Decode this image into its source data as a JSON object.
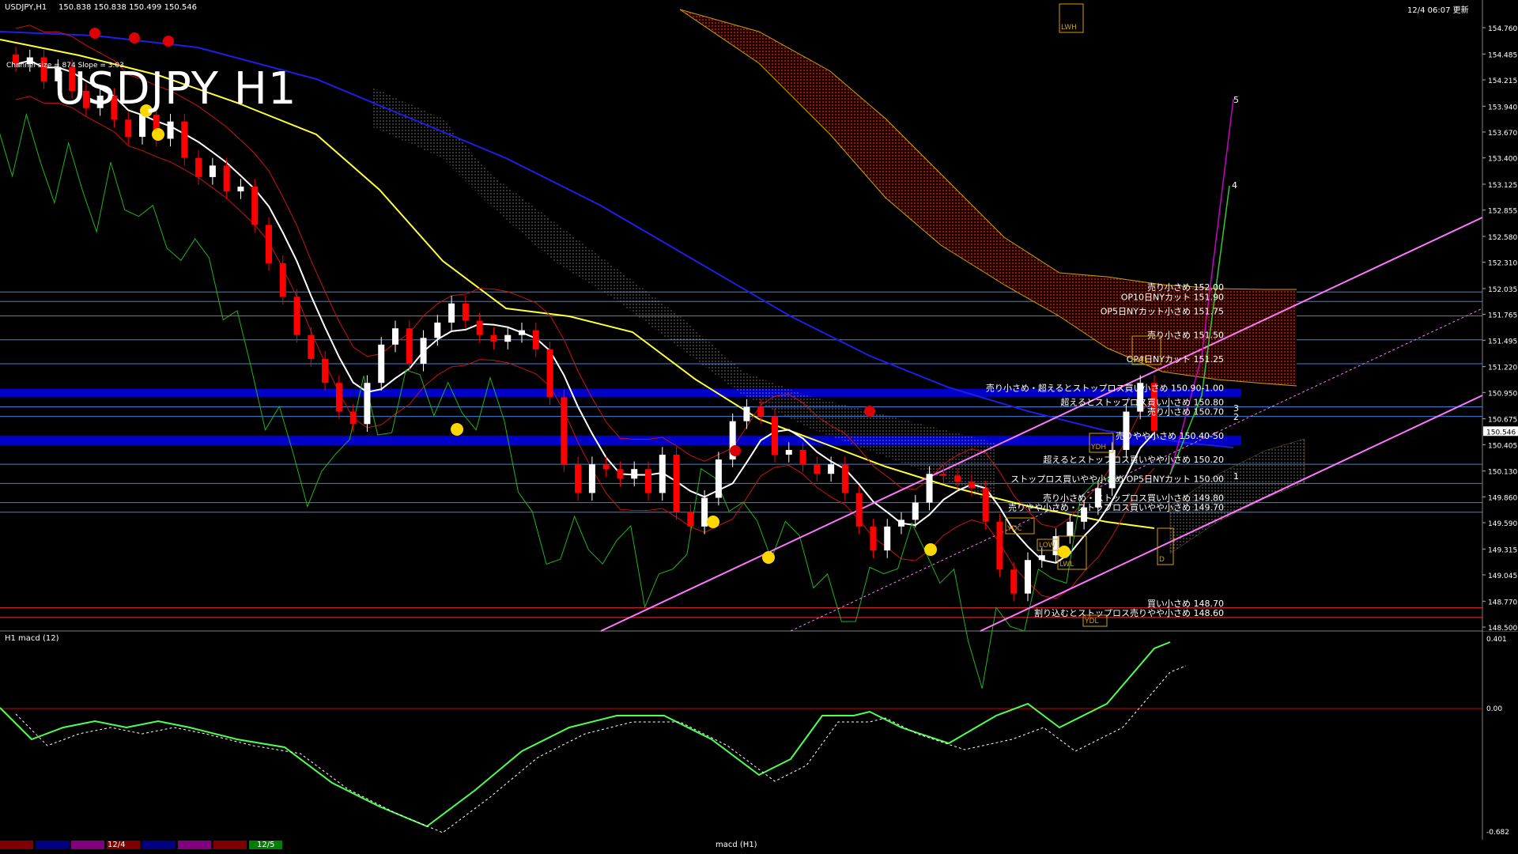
{
  "header": {
    "symbol": "USDJPY,H1",
    "ohlc": "150.838 150.838 150.499 150.546",
    "datetime": "12/4 06:07 更新",
    "channel_info": "Channel size = 874  Slope = 3.03",
    "big_title": "USDJPY H1",
    "sub_window": "H1  macd (12)"
  },
  "price_axis": {
    "ticks": [
      "154.760",
      "154.485",
      "154.215",
      "153.940",
      "153.670",
      "153.400",
      "153.125",
      "152.855",
      "152.580",
      "152.310",
      "152.035",
      "151.765",
      "151.495",
      "151.220",
      "150.950",
      "150.675",
      "150.405",
      "150.130",
      "149.860",
      "149.590",
      "149.315",
      "149.045",
      "148.770",
      "148.500"
    ],
    "current_price": "150.546",
    "current_price_color": "#ffffff"
  },
  "macd_axis": {
    "ticks": [
      "0.401",
      "0.00",
      "-0.682",
      "0"
    ]
  },
  "level_labels": [
    {
      "text": "売り小さめ 152.00"
    },
    {
      "text": "OP10日NYカット 151.90"
    },
    {
      "text": "OP5日NYカット小さめ 151.75"
    },
    {
      "text": "売り小さめ 151.50"
    },
    {
      "text": "OP4日NYカット 151.25"
    },
    {
      "text": "売り小さめ・超えるとストップロス買い小さめ 150.90-1.00"
    },
    {
      "text": "超えるとストップロス買い小さめ 150.80"
    },
    {
      "text": "売り小さめ 150.70"
    },
    {
      "text": "売りやや小さめ 150.40-50"
    },
    {
      "text": "超えるとストップロス買いやや小さめ 150.20"
    },
    {
      "text": "ストップロス買いやや小さめ  OP5日NYカット 150.00"
    },
    {
      "text": "売り小さめ・ストップロス買い小さめ 149.80"
    },
    {
      "text": "売りやや小さめ・ストップロス買いやや小さめ 149.70"
    },
    {
      "text": "買い小さめ 148.70"
    },
    {
      "text": "割り込むとストップロス売りやや小さめ 148.60"
    }
  ],
  "box_labels": [
    "LWH",
    "YDC",
    "LWL",
    "YDL",
    "LOW",
    "LWL",
    "YDH",
    "D"
  ],
  "wave_labels": [
    "5",
    "4",
    "3",
    "2",
    "1"
  ],
  "tabs": [
    "12/4",
    "12/5",
    "macd (H1)"
  ],
  "colors": {
    "background": "#000000",
    "bull_candle": "#ffffff",
    "bear_candle": "#ff0000",
    "ichimoku_cloud_bear": "#ff3c00",
    "ichimoku_cloud_bull": "#ffffff",
    "ma_short": "#ffffff",
    "ma_mid": "#ffff3c",
    "ma_long": "#1e1ee6",
    "bollinger": "#c81414",
    "chikou": "#1eb41e",
    "channel": "#ff78ff",
    "level_line": "#3c82dc",
    "band_zone": "#0000c8",
    "macd_up": "#50ff50",
    "macd_down": "#ff82b4",
    "signal": "#ffffff"
  },
  "chart_data": {
    "type": "line",
    "title": "USDJPY H1",
    "xlabel": "",
    "ylabel": "",
    "ylim": [
      148.5,
      154.9
    ],
    "grid": false,
    "close_series": [
      {
        "name": "",
        "values": [
          154.38,
          154.45,
          154.2,
          154.35,
          154.1,
          153.92,
          154.05,
          153.8,
          153.62,
          153.85,
          153.6,
          153.78,
          153.4,
          153.2,
          153.32,
          153.05,
          153.1,
          152.7,
          152.3,
          151.95,
          151.55,
          151.3,
          151.05,
          150.75,
          150.62,
          151.05,
          151.45,
          151.62,
          151.25,
          151.52,
          151.68,
          151.88,
          151.7,
          151.55,
          151.48,
          151.55,
          151.6,
          151.4,
          150.9,
          150.2,
          149.9,
          150.2,
          150.15,
          150.05,
          150.15,
          149.9,
          150.3,
          149.7,
          149.55,
          149.85,
          150.25,
          150.65,
          150.8,
          150.7,
          150.3,
          150.35,
          150.2,
          150.1,
          150.2,
          149.9,
          149.55,
          149.3,
          149.55,
          149.62,
          149.8,
          150.1,
          150.08,
          150.02,
          149.95,
          149.6,
          149.1,
          148.85,
          149.2,
          149.25,
          149.45,
          149.6,
          149.75,
          149.95,
          150.35,
          150.75,
          151.05,
          150.55
        ]
      }
    ],
    "macd": {
      "ylim": [
        -0.682,
        0.401
      ]
    }
  }
}
